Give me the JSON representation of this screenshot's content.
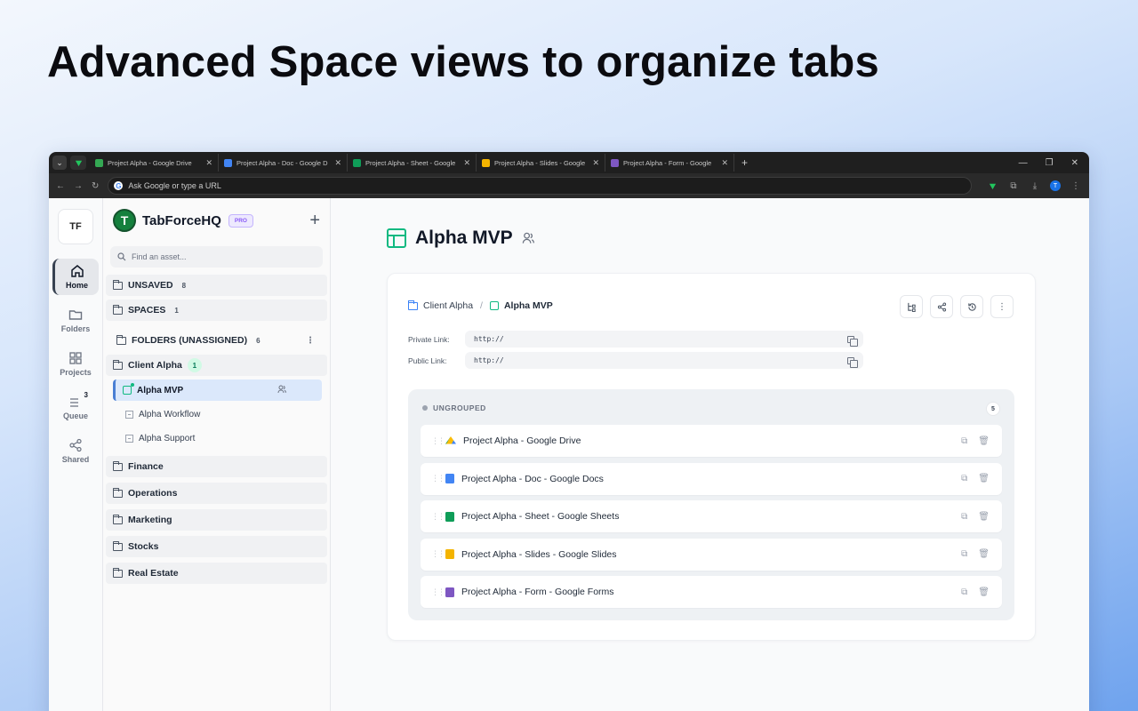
{
  "headline": "Advanced Space views to organize tabs",
  "browser": {
    "tabs": [
      {
        "title": "Project Alpha - Google Drive",
        "icon": "google-drive-icon",
        "color": "#34a853"
      },
      {
        "title": "Project Alpha - Doc - Google D",
        "icon": "google-docs-icon",
        "color": "#4285f4"
      },
      {
        "title": "Project Alpha - Sheet - Google",
        "icon": "google-sheets-icon",
        "color": "#0f9d58"
      },
      {
        "title": "Project Alpha - Slides - Google",
        "icon": "google-slides-icon",
        "color": "#f4b400"
      },
      {
        "title": "Project Alpha - Form - Google",
        "icon": "google-forms-icon",
        "color": "#7e57c2"
      }
    ],
    "address_placeholder": "Ask Google or type a URL",
    "profile_initial": "T"
  },
  "rail": {
    "avatar": "TF",
    "items": [
      {
        "label": "Home",
        "icon": "home-icon",
        "active": true
      },
      {
        "label": "Folders",
        "icon": "folder-icon"
      },
      {
        "label": "Projects",
        "icon": "grid-icon"
      },
      {
        "label": "Queue",
        "icon": "queue-icon",
        "badge": "3"
      },
      {
        "label": "Shared",
        "icon": "share-icon"
      }
    ]
  },
  "sidebar": {
    "brand": "TabForceHQ",
    "brand_initial": "T",
    "pro": "PRO",
    "search_placeholder": "Find an asset...",
    "unsaved": {
      "label": "UNSAVED",
      "count": "8"
    },
    "spaces": {
      "label": "SPACES",
      "count": "1"
    },
    "folders_unassigned": {
      "label": "FOLDERS (UNASSIGNED)",
      "count": "6"
    },
    "client": {
      "label": "Client Alpha",
      "count": "1"
    },
    "space_items": [
      {
        "label": "Alpha MVP",
        "active": true
      },
      {
        "label": "Alpha Workflow"
      },
      {
        "label": "Alpha Support"
      }
    ],
    "folders": [
      "Finance",
      "Operations",
      "Marketing",
      "Stocks",
      "Real Estate"
    ]
  },
  "main": {
    "title": "Alpha MVP",
    "breadcrumb": {
      "parent": "Client Alpha",
      "current": "Alpha MVP"
    },
    "private_link_label": "Private Link:",
    "private_link_value": "http://",
    "public_link_label": "Public Link:",
    "public_link_value": "http://",
    "group": {
      "label": "UNGROUPED",
      "count": "5",
      "tabs": [
        {
          "title": "Project Alpha - Google Drive",
          "kind": "drive"
        },
        {
          "title": "Project Alpha - Doc - Google Docs",
          "kind": "docs"
        },
        {
          "title": "Project Alpha - Sheet - Google Sheets",
          "kind": "sheets"
        },
        {
          "title": "Project Alpha - Slides - Google Slides",
          "kind": "slides"
        },
        {
          "title": "Project Alpha - Form - Google Forms",
          "kind": "forms"
        }
      ]
    }
  },
  "colors": {
    "accent_green": "#10b981",
    "brand_green": "#15803d",
    "active_blue": "#4a7fd4"
  }
}
